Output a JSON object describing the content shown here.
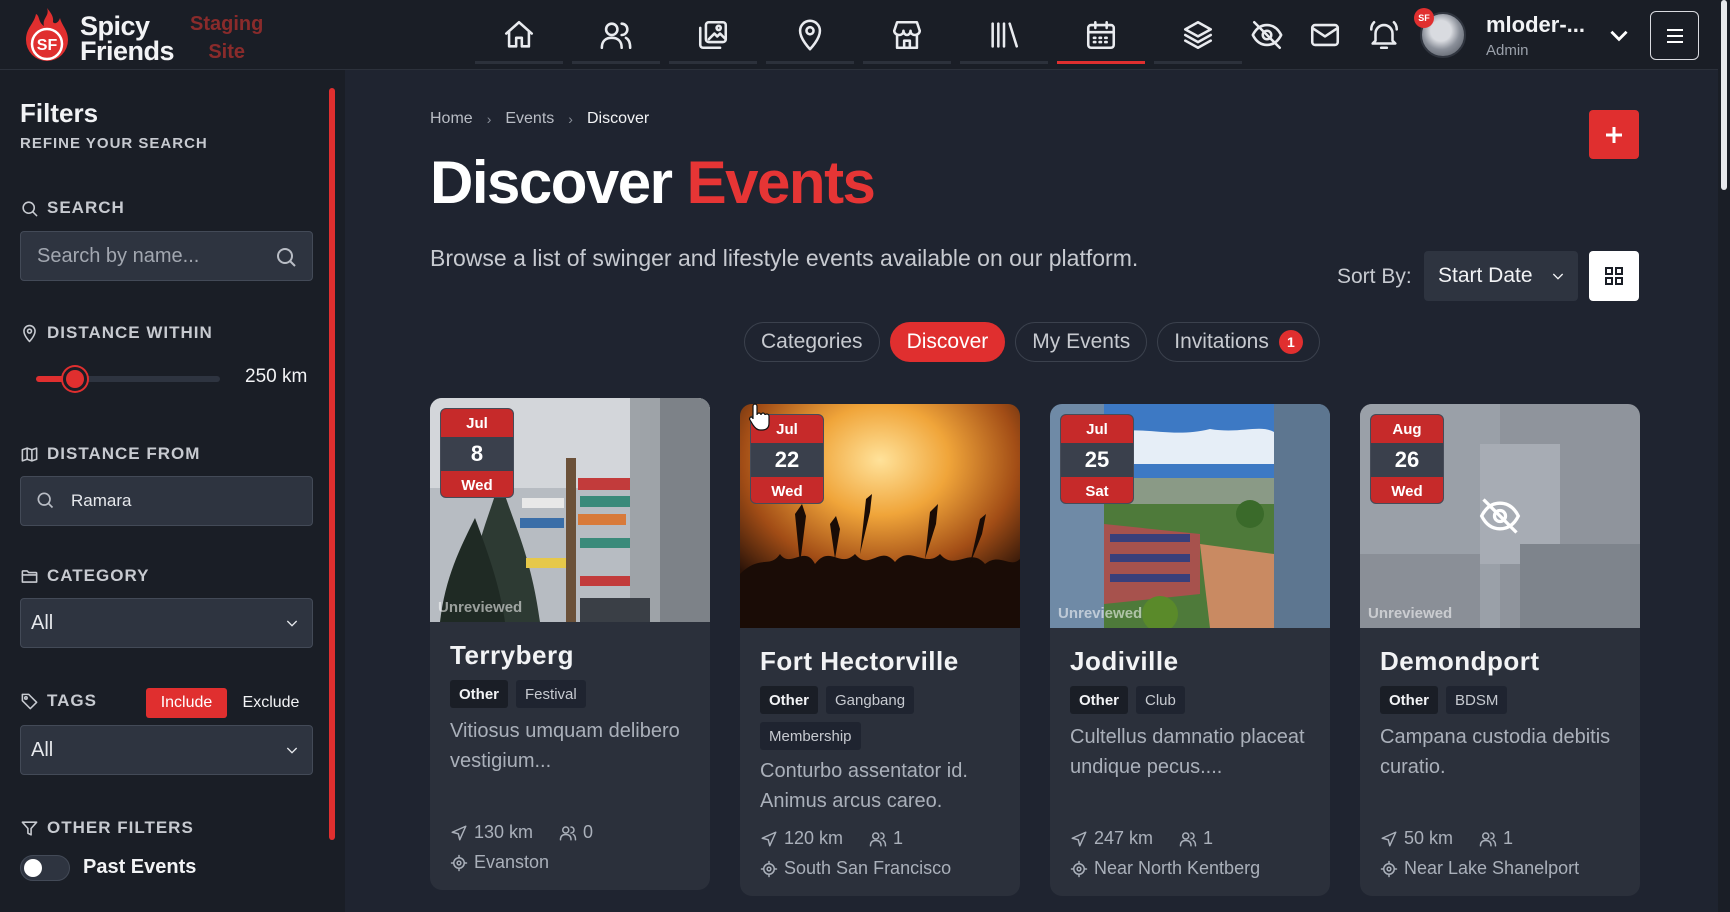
{
  "brand": {
    "name_line1": "Spicy",
    "name_line2": "Friends",
    "env_line1": "Staging",
    "env_line2": "Site",
    "logo_text": "SF"
  },
  "colors": {
    "accent": "#e02f2f",
    "bg": "#1f2430",
    "panel": "#1a1e26",
    "card": "#2b303b"
  },
  "nav": {
    "items": [
      {
        "icon": "home-icon"
      },
      {
        "icon": "users-icon"
      },
      {
        "icon": "photos-icon"
      },
      {
        "icon": "location-pin-icon"
      },
      {
        "icon": "store-icon"
      },
      {
        "icon": "library-icon"
      },
      {
        "icon": "calendar-icon",
        "active": true
      },
      {
        "icon": "layers-icon"
      }
    ],
    "right_icons": [
      "eye-off-icon",
      "mail-icon",
      "bell-icon"
    ]
  },
  "user": {
    "name": "mloder-...",
    "role": "Admin",
    "badge": "SF"
  },
  "sidebar": {
    "title": "Filters",
    "subtitle": "REFINE YOUR SEARCH",
    "search": {
      "label": "SEARCH",
      "placeholder": "Search by name..."
    },
    "distance_within": {
      "label": "DISTANCE WITHIN",
      "value_text": "250 km",
      "level_fraction": 0.21
    },
    "distance_from": {
      "label": "DISTANCE FROM",
      "value": "Ramara"
    },
    "category": {
      "label": "CATEGORY",
      "value": "All"
    },
    "tags": {
      "label": "TAGS",
      "include": "Include",
      "exclude": "Exclude",
      "value": "All"
    },
    "other": {
      "label": "OTHER FILTERS",
      "past_events": "Past Events",
      "past_events_on": false
    }
  },
  "main": {
    "breadcrumb": [
      "Home",
      "Events",
      "Discover"
    ],
    "title_main": "Discover",
    "title_accent": "Events",
    "description": "Browse a list of swinger and lifestyle events available on our platform.",
    "sort_label": "Sort By:",
    "sort_value": "Start Date",
    "tabs": [
      {
        "label": "Categories"
      },
      {
        "label": "Discover",
        "active": true
      },
      {
        "label": "My Events"
      },
      {
        "label": "Invitations",
        "badge": "1"
      }
    ]
  },
  "events": [
    {
      "month": "Jul",
      "day": "8",
      "weekday": "Wed",
      "status": "Unreviewed",
      "title": "Terryberg",
      "chips": [
        "Other",
        "Festival"
      ],
      "description": "Vitiosus umquam delibero vestigium...",
      "distance": "130 km",
      "attendees": "0",
      "location": "Evanston"
    },
    {
      "month": "Jul",
      "day": "22",
      "weekday": "Wed",
      "status": "",
      "title": "Fort Hectorville",
      "chips": [
        "Other",
        "Gangbang",
        "Membership"
      ],
      "description": "Conturbo assentator id. Animus arcus careo.",
      "distance": "120 km",
      "attendees": "1",
      "location": "South San Francisco"
    },
    {
      "month": "Jul",
      "day": "25",
      "weekday": "Sat",
      "status": "Unreviewed",
      "title": "Jodiville",
      "chips": [
        "Other",
        "Club"
      ],
      "description": "Cultellus damnatio placeat undique pecus....",
      "distance": "247 km",
      "attendees": "1",
      "location": "Near North Kentberg"
    },
    {
      "month": "Aug",
      "day": "26",
      "weekday": "Wed",
      "status": "Unreviewed",
      "title": "Demondport",
      "chips": [
        "Other",
        "BDSM"
      ],
      "description": "Campana custodia debitis curatio.",
      "distance": "50 km",
      "attendees": "1",
      "location": "Near Lake Shanelport"
    }
  ]
}
